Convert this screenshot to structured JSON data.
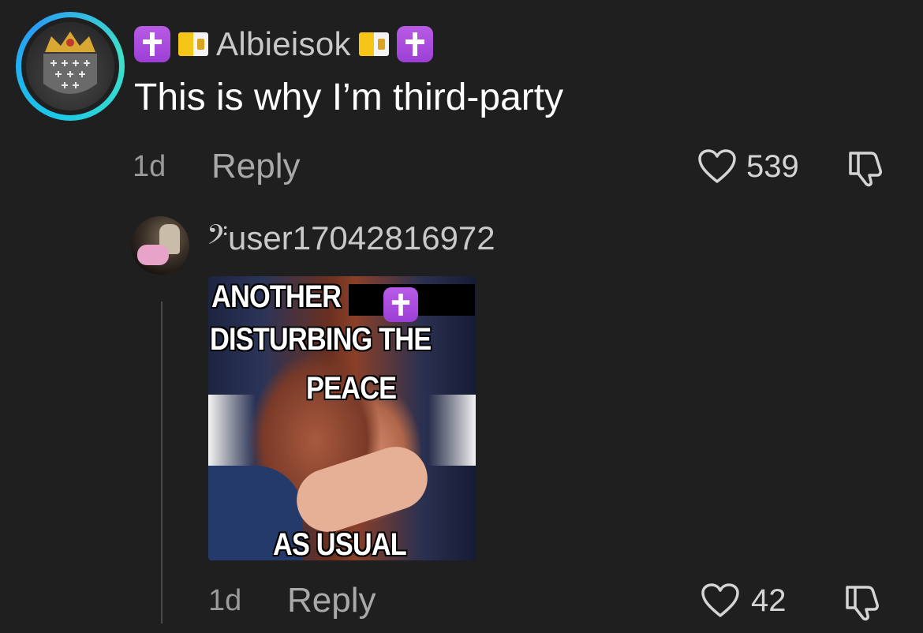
{
  "comment": {
    "username": "Albieisok",
    "text": "This is why I’m third-party",
    "time": "1d",
    "reply_label": "Reply",
    "likes": "539",
    "badges": [
      "cross-badge",
      "vatican-flag",
      "vatican-flag",
      "cross-badge"
    ]
  },
  "reply": {
    "username": "𝄢user17042816972",
    "time": "1d",
    "reply_label": "Reply",
    "likes": "42",
    "meme": {
      "line1": "ANOTHER",
      "line2": "DISTURBING THE",
      "line3": "PEACE",
      "line4": "AS USUAL"
    }
  },
  "colors": {
    "background": "#1f1f1f",
    "ring": "#1ac8e8",
    "cross_badge": "#a64bdc",
    "muted_text": "#9a9a9a"
  },
  "icons": {
    "like": "heart-outline-icon",
    "dislike": "thumbs-down-icon",
    "cross": "latin-cross-icon"
  }
}
